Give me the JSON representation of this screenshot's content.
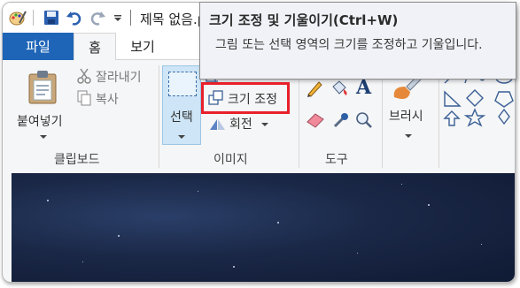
{
  "title_bar": {
    "document_title": "제목 없음.p",
    "quick_access_icons": [
      "paint-app-icon",
      "save-icon",
      "undo-icon",
      "redo-icon",
      "customize-dropdown-icon"
    ]
  },
  "tabs": {
    "file": "파일",
    "home": "홈",
    "view": "보기"
  },
  "ribbon": {
    "clipboard": {
      "paste": "붙여넣기",
      "cut": "잘라내기",
      "copy": "복사",
      "group_label": "클립보드"
    },
    "image": {
      "select": "선택",
      "resize": "크기 조정",
      "rotate": "회전",
      "group_label": "이미지"
    },
    "tools": {
      "group_label": "도구"
    },
    "brushes": {
      "label": "브러시"
    }
  },
  "tooltip": {
    "title": "크기 조정 및 기울이기(Ctrl+W)",
    "body": "그림 또는 선택 영역의 크기를 조정하고 기울입니다."
  },
  "colors": {
    "file_tab": "#1e65b8",
    "highlight": "#e8202a",
    "canvas": "#1a2746"
  }
}
